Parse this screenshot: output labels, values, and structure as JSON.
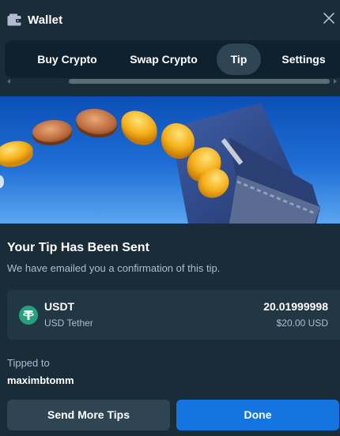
{
  "header": {
    "title": "Wallet",
    "icon": "wallet-icon",
    "close_icon": "close-icon"
  },
  "tabs": [
    {
      "label": "Buy Crypto",
      "active": false
    },
    {
      "label": "Swap Crypto",
      "active": false
    },
    {
      "label": "Tip",
      "active": true
    },
    {
      "label": "Settings",
      "active": false
    }
  ],
  "hero": {
    "image": "gold-coins-into-wallet-illustration"
  },
  "confirmation": {
    "heading": "Your Tip Has Been Sent",
    "subtext": "We have emailed you a confirmation of this tip."
  },
  "asset": {
    "icon": "tether-icon",
    "symbol": "USDT",
    "name": "USD Tether",
    "amount": "20.01999998",
    "usd_value": "$20.00 USD"
  },
  "recipient": {
    "label": "Tipped to",
    "username": "maximbtomm"
  },
  "actions": {
    "send_more_label": "Send More Tips",
    "done_label": "Done"
  },
  "colors": {
    "background": "#1a2c38",
    "panel": "#0f212e",
    "card": "#213743",
    "secondary_button": "#2f4553",
    "primary_button": "#1475e1",
    "muted_text": "#b1bad3",
    "tether_green": "#26a17b"
  }
}
